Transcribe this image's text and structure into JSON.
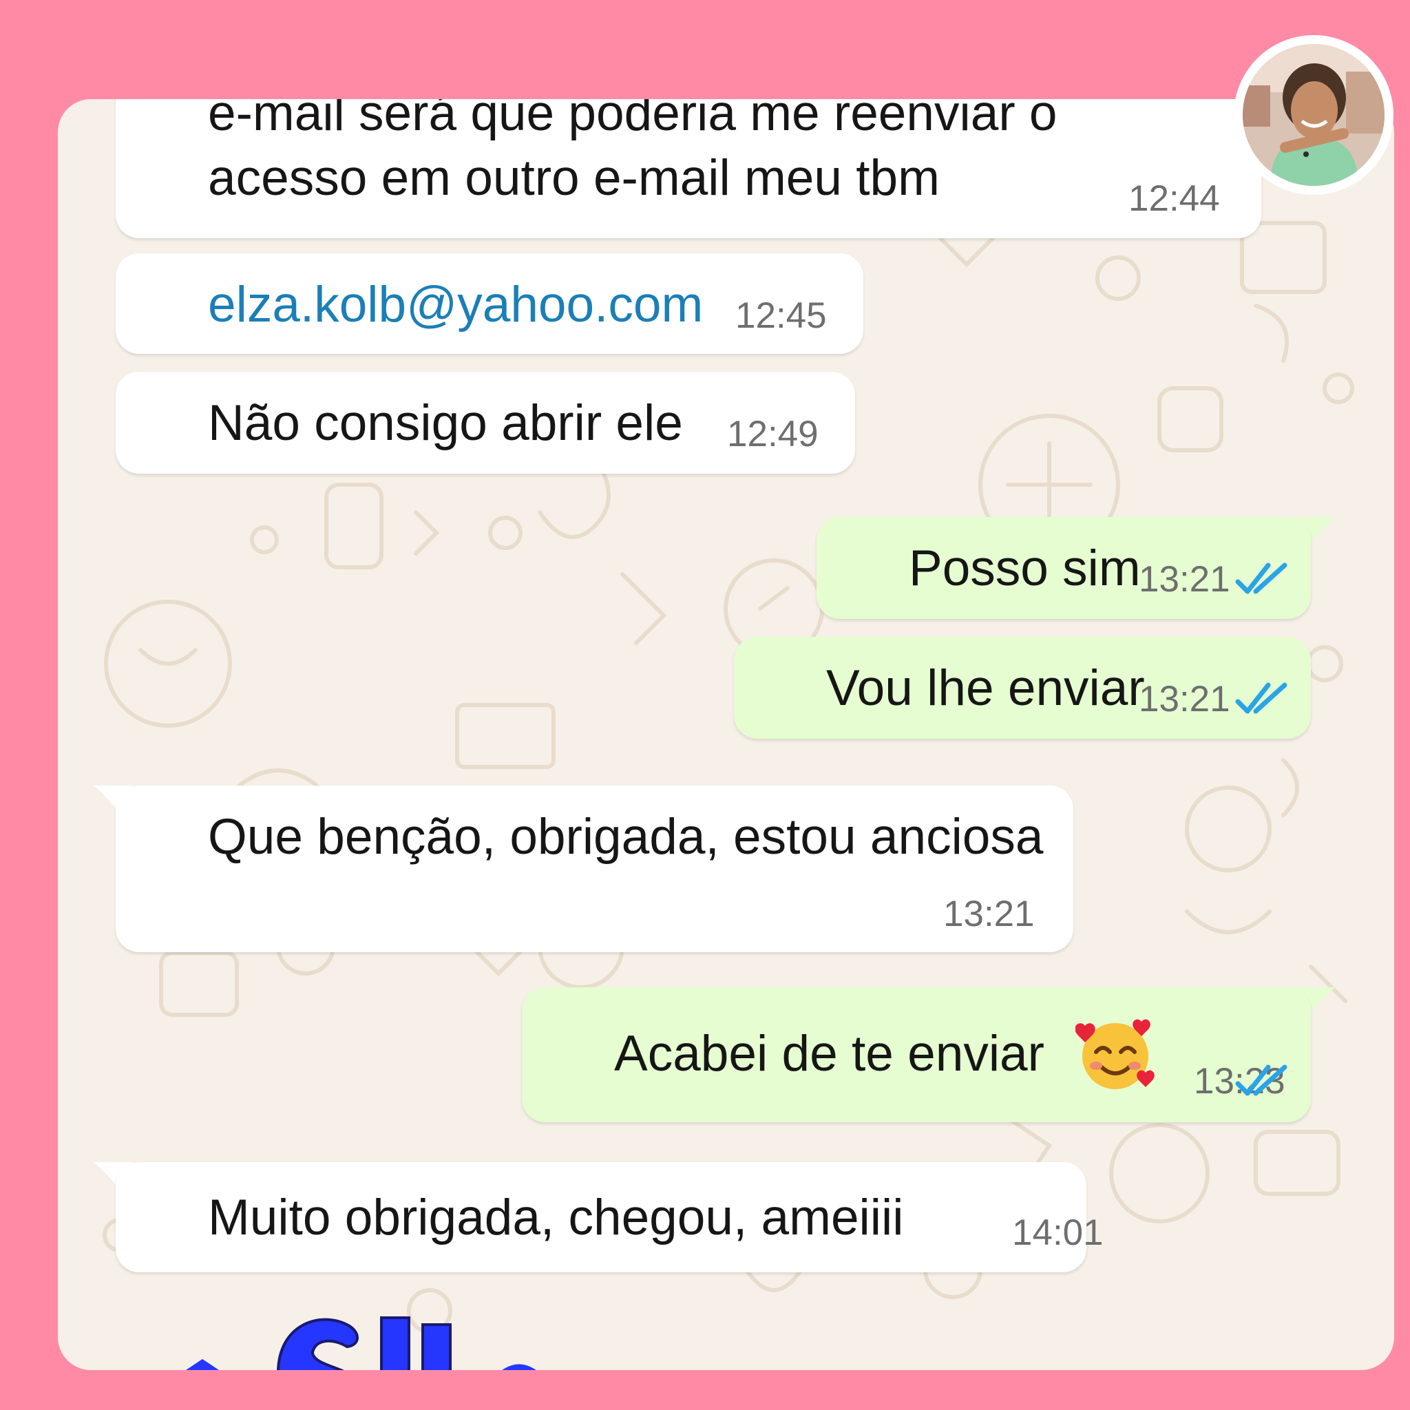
{
  "messages": [
    {
      "id": "m1",
      "direction": "incoming",
      "line1": "e-mail será que poderia me reenviar o",
      "line2": "acesso em outro e-mail meu tbm",
      "time": "12:44"
    },
    {
      "id": "m2",
      "direction": "incoming",
      "text": "elza.kolb@yahoo.com",
      "is_link": true,
      "time": "12:45"
    },
    {
      "id": "m3",
      "direction": "incoming",
      "text": "Não consigo abrir  ele",
      "time": "12:49"
    },
    {
      "id": "m4",
      "direction": "outgoing",
      "text": "Posso sim",
      "time": "13:21",
      "status": "read"
    },
    {
      "id": "m5",
      "direction": "outgoing",
      "text": "Vou lhe enviar",
      "time": "13:21",
      "status": "read"
    },
    {
      "id": "m6",
      "direction": "incoming",
      "text": "Que benção, obrigada, estou anciosa",
      "time": "13:21"
    },
    {
      "id": "m7",
      "direction": "outgoing",
      "text": "Acabei de te enviar",
      "emoji": "smiling-face-with-hearts",
      "time": "13:23",
      "status": "read"
    },
    {
      "id": "m8",
      "direction": "incoming",
      "text": "Muito obrigada, chegou, ameiiii",
      "time": "14:01"
    }
  ],
  "icons": {
    "read_receipt": "double-check-icon",
    "avatar": "contact-avatar",
    "emoji": "smiling-face-with-hearts-emoji"
  },
  "colors": {
    "frame": "#ff8aa6",
    "chat_background": "#f6f0e8",
    "incoming_bubble": "#ffffff",
    "outgoing_bubble": "#e5fdd0",
    "link": "#1b7fb7",
    "read_ticks": "#2aa4e6",
    "sticker_text": "#2436ff"
  }
}
